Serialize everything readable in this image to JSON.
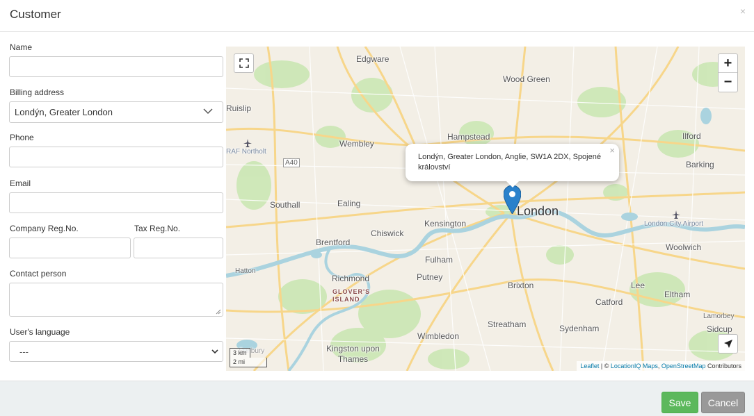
{
  "dialog": {
    "title": "Customer",
    "close_glyph": "×"
  },
  "form": {
    "name_label": "Name",
    "name_value": "",
    "billing_label": "Billing address",
    "billing_value": "Londýn, Greater London",
    "phone_label": "Phone",
    "phone_value": "",
    "email_label": "Email",
    "email_value": "",
    "company_reg_label": "Company Reg.No.",
    "company_reg_value": "",
    "tax_reg_label": "Tax Reg.No.",
    "tax_reg_value": "",
    "contact_label": "Contact person",
    "contact_value": "",
    "language_label": "User's language",
    "language_value": "---"
  },
  "map": {
    "zoom_in": "+",
    "zoom_out": "−",
    "popup_text": "Londýn, Greater London, Anglie, SW1A 2DX, Spojené království",
    "popup_close": "×",
    "scale_km": "3 km",
    "scale_mi": "2 mi",
    "attribution": {
      "leaflet": "Leaflet",
      "separator": " | © ",
      "locationiq": "LocationIQ Maps",
      "comma": ", ",
      "osm": "OpenStreetMap",
      "contributors": " Contributors"
    },
    "places": {
      "edgware": "Edgware",
      "wood_green": "Wood Green",
      "ruislip": "Ruislip",
      "hampstead": "Hampstead",
      "wembley": "Wembley",
      "ilford": "Ilford",
      "raf_northolt": "RAF Northolt",
      "a40": "A40",
      "barking": "Barking",
      "southall": "Southall",
      "ealing": "Ealing",
      "london": "London",
      "kensington": "Kensington",
      "london_city_airport": "London City Airport",
      "chiswick": "Chiswick",
      "brentford": "Brentford",
      "woolwich": "Woolwich",
      "hatton": "Hatton",
      "fulham": "Fulham",
      "richmond": "Richmond",
      "putney": "Putney",
      "brixton": "Brixton",
      "lee": "Lee",
      "eltham": "Eltham",
      "glovers_island": "GLOVER'S ISLAND",
      "catford": "Catford",
      "lamorbey": "Lamorbey",
      "streatham": "Streatham",
      "sydenham": "Sydenham",
      "sidcup": "Sidcup",
      "wimbledon": "Wimbledon",
      "kingston": "Kingston upon Thames",
      "sunbury": "Sunbury"
    }
  },
  "footer": {
    "save_label": "Save",
    "cancel_label": "Cancel"
  },
  "colors": {
    "save": "#5cb85c",
    "cancel": "#999999",
    "marker": "#2a81cb",
    "water": "#aad3df",
    "park": "#c8e6b0",
    "road_major": "#f7d68a"
  }
}
